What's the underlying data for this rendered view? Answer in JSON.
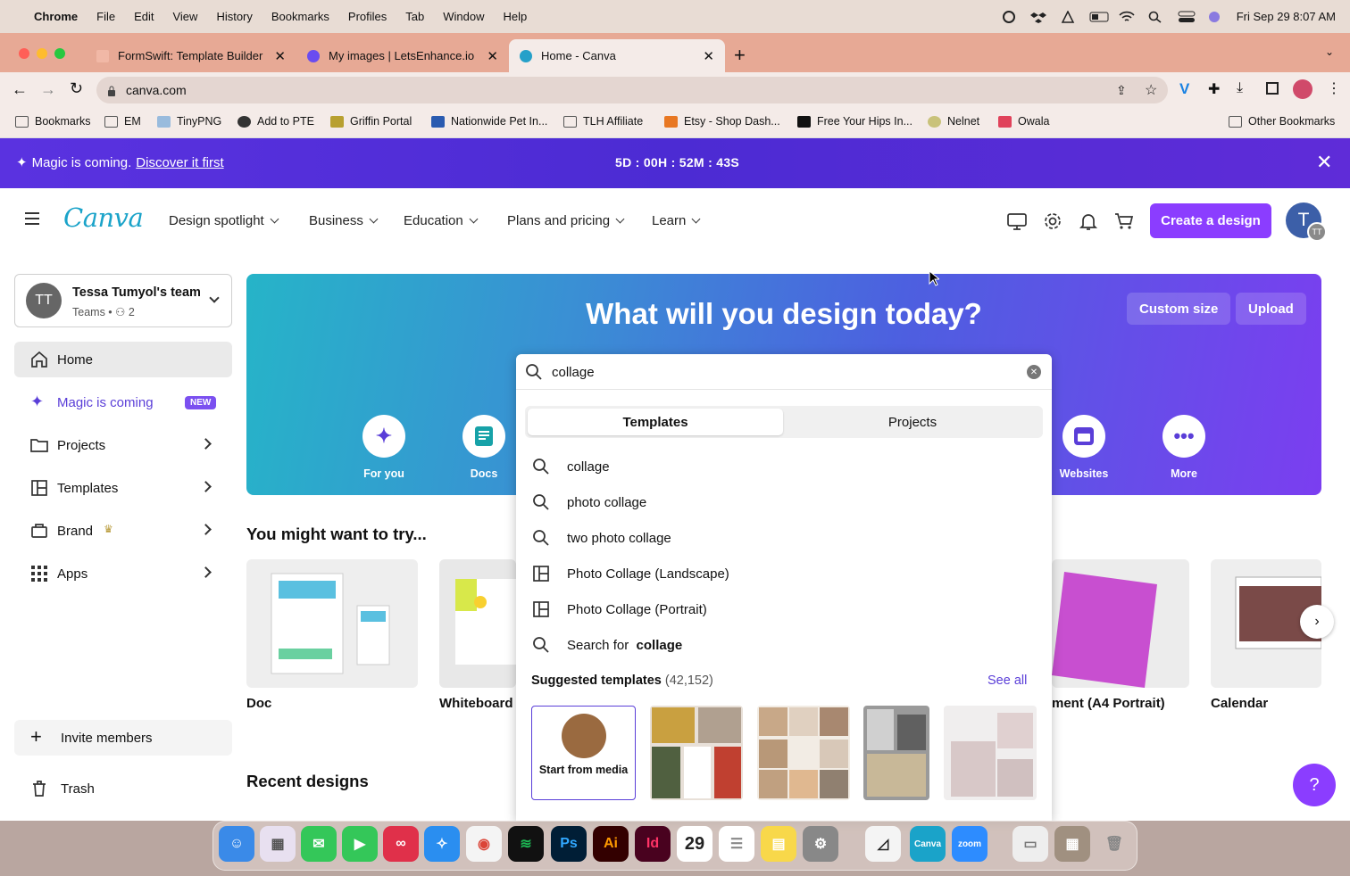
{
  "menubar": {
    "app": "Chrome",
    "items": [
      "File",
      "Edit",
      "View",
      "History",
      "Bookmarks",
      "Profiles",
      "Tab",
      "Window",
      "Help"
    ],
    "datetime": "Fri Sep 29  8:07 AM"
  },
  "tabs": [
    {
      "title": "FormSwift: Template Builder",
      "favicon_color": "#e9a"
    },
    {
      "title": "My images | LetsEnhance.io -",
      "favicon_color": "#6a4cf0"
    },
    {
      "title": "Home - Canva",
      "favicon_color": "#25a0c9"
    }
  ],
  "omnibox": {
    "url": "canva.com"
  },
  "bookmarks": [
    "Bookmarks",
    "EM",
    "TinyPNG",
    "Add to PTE",
    "Griffin Portal",
    "Nationwide Pet In...",
    "TLH Affiliate",
    "Etsy - Shop Dash...",
    "Free Your Hips In...",
    "Nelnet",
    "Owala",
    "Other Bookmarks"
  ],
  "banner": {
    "text": "Magic is coming.",
    "link": "Discover it first",
    "countdown": "5D : 00H : 52M : 43S"
  },
  "nav": {
    "logo": "Canva",
    "items": [
      "Design spotlight",
      "Business",
      "Education",
      "Plans and pricing",
      "Learn"
    ],
    "create_label": "Create a design",
    "avatar": "T",
    "avatar_small": "TT"
  },
  "team": {
    "initials": "TT",
    "name": "Tessa Tumyol's team",
    "sub": "Teams  •  ⚇ 2"
  },
  "sidebar": [
    {
      "label": "Home"
    },
    {
      "label": "Magic is coming",
      "badge": "NEW"
    },
    {
      "label": "Projects"
    },
    {
      "label": "Templates"
    },
    {
      "label": "Brand"
    },
    {
      "label": "Apps"
    }
  ],
  "sidebar_bottom": {
    "invite": "Invite members",
    "trash": "Trash"
  },
  "hero": {
    "title": "What will you design today?",
    "custom_size": "Custom size",
    "upload": "Upload",
    "categories": [
      "For you",
      "Docs",
      "Websites",
      "More"
    ]
  },
  "try_title": "You might want to try...",
  "cards": [
    "Doc",
    "Whiteboard",
    "ment (A4 Portrait)",
    "Calendar"
  ],
  "recent_title": "Recent designs",
  "search": {
    "query": "collage",
    "tabs": [
      "Templates",
      "Projects"
    ],
    "suggestions": [
      {
        "text": "collage",
        "icon": "search-icon"
      },
      {
        "text": "photo collage",
        "icon": "search-icon"
      },
      {
        "text": "two photo collage",
        "icon": "search-icon"
      },
      {
        "text": "Photo Collage (Landscape)",
        "icon": "template-icon"
      },
      {
        "text": "Photo Collage (Portrait)",
        "icon": "template-icon"
      },
      {
        "text": "Search for ",
        "bold": "collage",
        "icon": "search-icon"
      }
    ],
    "suggested_title": "Suggested templates",
    "suggested_count": "(42,152)",
    "see_all": "See all",
    "start_media": "Start from media"
  },
  "help": "?",
  "colors": {
    "accent": "#8b3dff",
    "banner": "#4c2bd3"
  }
}
